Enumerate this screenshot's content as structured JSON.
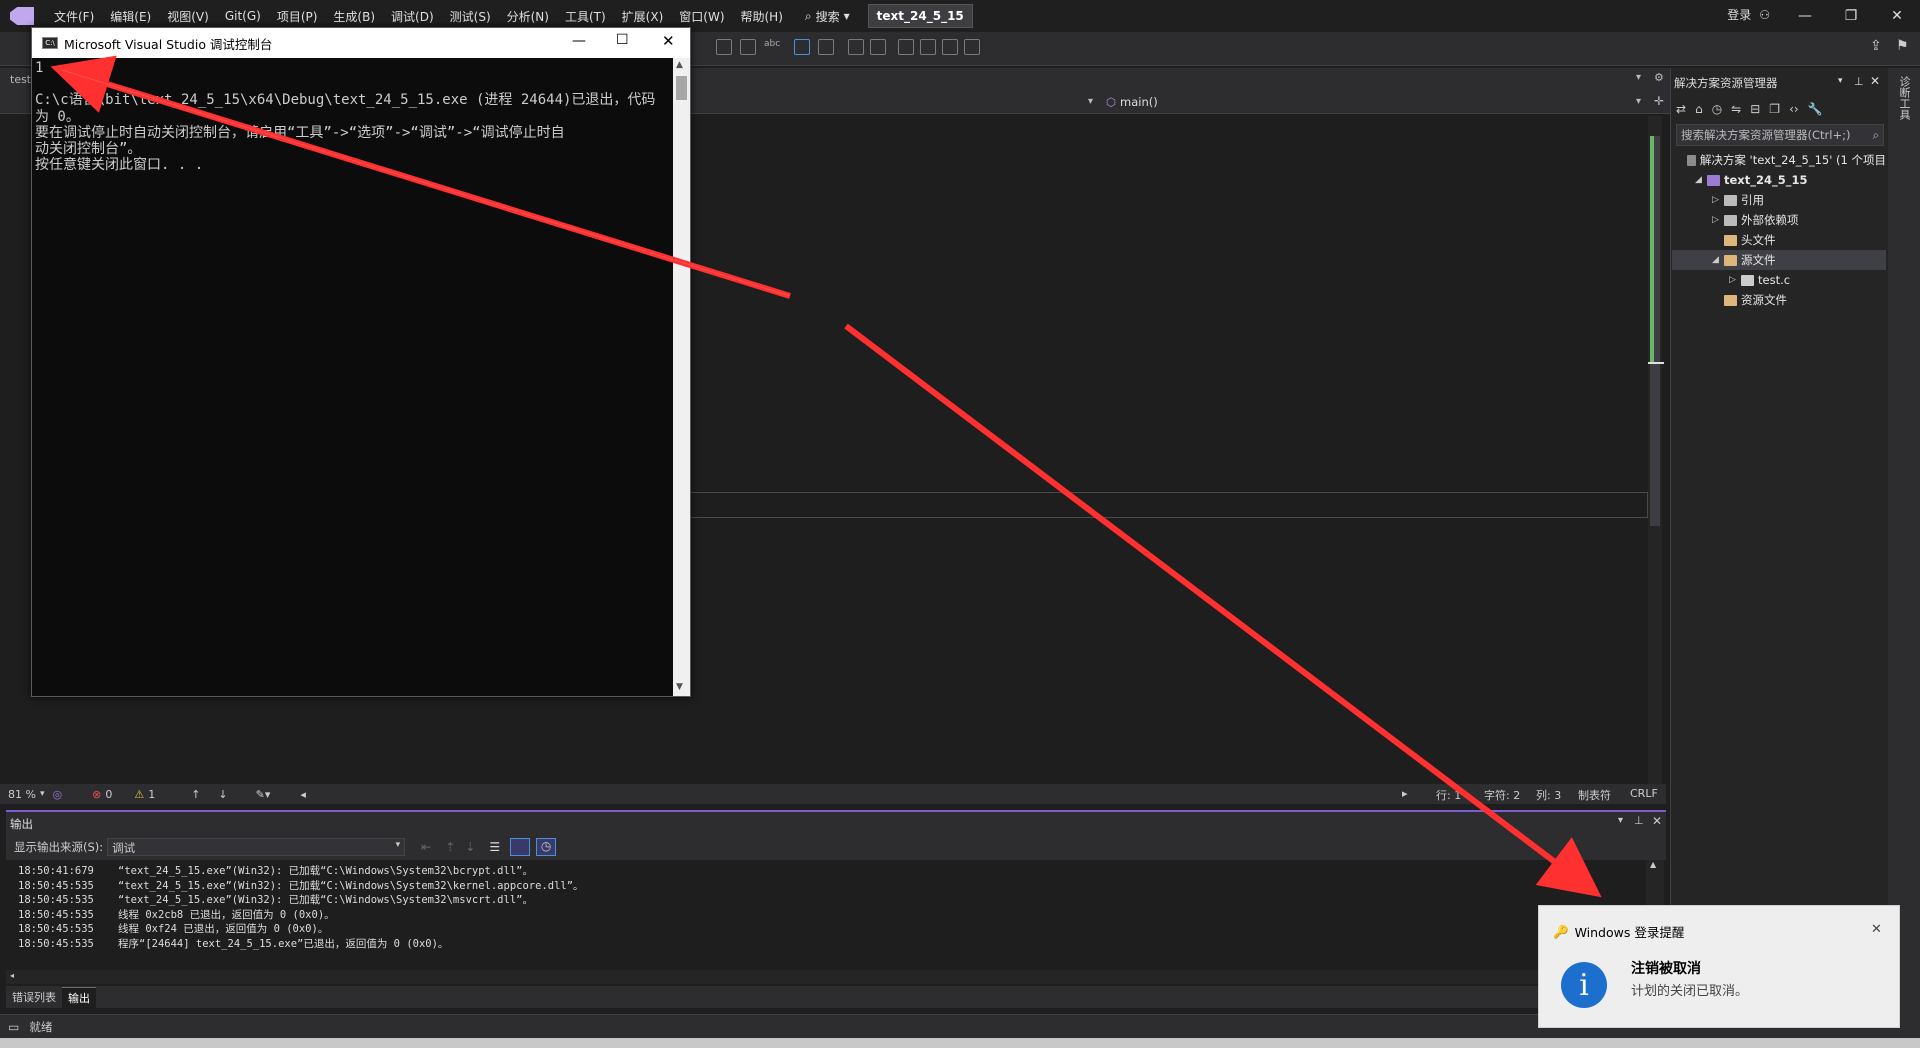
{
  "menu": {
    "items": [
      "文件(F)",
      "编辑(E)",
      "视图(V)",
      "Git(G)",
      "项目(P)",
      "生成(B)",
      "调试(D)",
      "测试(S)",
      "分析(N)",
      "工具(T)",
      "扩展(X)",
      "窗口(W)",
      "帮助(H)"
    ],
    "search_label": "搜索",
    "project_name": "text_24_5_15",
    "login": "登录"
  },
  "editor": {
    "doc_tab_label": "test",
    "scope_label": "main()",
    "zoom": "81 %",
    "errors": "0",
    "warnings": "1",
    "line_label": "行: 1",
    "char_label": "字符: 2",
    "col_label": "列: 3",
    "tab_label": "制表符",
    "eol_label": "CRLF"
  },
  "console": {
    "title": "Microsoft Visual Studio 调试控制台",
    "lines": [
      "1",
      "",
      "C:\\c语言\\bit\\text_24_5_15\\x64\\Debug\\text_24_5_15.exe (进程 24644)已退出，代码",
      "为 0。",
      "要在调试停止时自动关闭控制台，请启用“工具”->“选项”->“调试”->“调试停止时自",
      "动关闭控制台”。",
      "按任意键关闭此窗口. . ."
    ]
  },
  "output": {
    "title": "输出",
    "source_label": "显示输出来源(S):",
    "source_value": "调试",
    "lines": [
      {
        "time": "18:50:41:679",
        "text": "“text_24_5_15.exe”(Win32): 已加载“C:\\Windows\\System32\\bcrypt.dll”。"
      },
      {
        "time": "18:50:45:535",
        "text": "“text_24_5_15.exe”(Win32): 已加载“C:\\Windows\\System32\\kernel.appcore.dll”。"
      },
      {
        "time": "18:50:45:535",
        "text": "“text_24_5_15.exe”(Win32): 已加载“C:\\Windows\\System32\\msvcrt.dll”。"
      },
      {
        "time": "18:50:45:535",
        "text": "线程 0x2cb8 已退出，返回值为 0 (0x0)。"
      },
      {
        "time": "18:50:45:535",
        "text": "线程 0xf24 已退出，返回值为 0 (0x0)。"
      },
      {
        "time": "18:50:45:535",
        "text": "程序“[24644] text_24_5_15.exe”已退出，返回值为 0 (0x0)。"
      }
    ]
  },
  "bottom_tabs": [
    "错误列表",
    "输出"
  ],
  "status": {
    "ready": "就绪"
  },
  "solution_explorer": {
    "title": "解决方案资源管理器",
    "search_placeholder": "搜索解决方案资源管理器(Ctrl+;)",
    "tree": [
      {
        "label": "解决方案 'text_24_5_15' (1 个项目",
        "indent": 0,
        "arrow": "",
        "icon_color": "#8c8c8c"
      },
      {
        "label": "text_24_5_15",
        "indent": 1,
        "arrow": "◢",
        "icon_color": "#9b7bd4",
        "bold": true
      },
      {
        "label": "引用",
        "indent": 2,
        "arrow": "▷",
        "icon_color": "#bbbbbb"
      },
      {
        "label": "外部依赖项",
        "indent": 2,
        "arrow": "▷",
        "icon_color": "#bbbbbb"
      },
      {
        "label": "头文件",
        "indent": 2,
        "arrow": "",
        "icon_color": "#dcb67a"
      },
      {
        "label": "源文件",
        "indent": 2,
        "arrow": "◢",
        "icon_color": "#dcb67a",
        "selected": true
      },
      {
        "label": "test.c",
        "indent": 3,
        "arrow": "▷",
        "icon_color": "#cccccc"
      },
      {
        "label": "资源文件",
        "indent": 2,
        "arrow": "",
        "icon_color": "#dcb67a"
      }
    ]
  },
  "right_strip_label": "诊断工具",
  "toast": {
    "app": "Windows 登录提醒",
    "title": "注销被取消",
    "body": "计划的关闭已取消。"
  },
  "colors": {
    "accent": "#7f5cd6",
    "arrow": "#ff3333",
    "toast_icon": "#1c6fcc"
  }
}
